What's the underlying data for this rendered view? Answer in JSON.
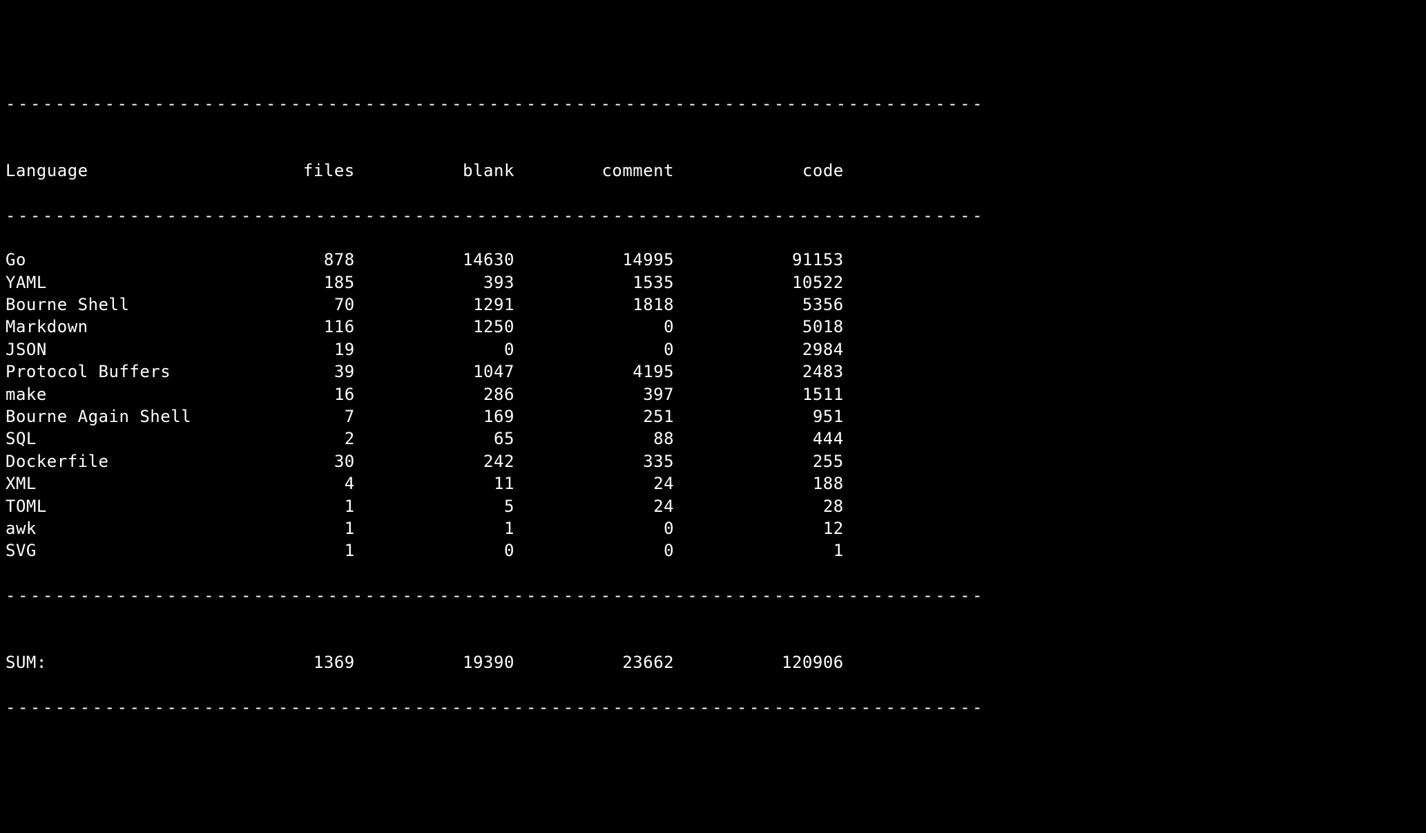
{
  "headers": {
    "language": "Language",
    "files": "files",
    "blank": "blank",
    "comment": "comment",
    "code": "code"
  },
  "separator": "-------------------------------------------------------------------------------",
  "rows": [
    {
      "language": "Go",
      "files": "878",
      "blank": "14630",
      "comment": "14995",
      "code": "91153"
    },
    {
      "language": "YAML",
      "files": "185",
      "blank": "393",
      "comment": "1535",
      "code": "10522"
    },
    {
      "language": "Bourne Shell",
      "files": "70",
      "blank": "1291",
      "comment": "1818",
      "code": "5356"
    },
    {
      "language": "Markdown",
      "files": "116",
      "blank": "1250",
      "comment": "0",
      "code": "5018"
    },
    {
      "language": "JSON",
      "files": "19",
      "blank": "0",
      "comment": "0",
      "code": "2984"
    },
    {
      "language": "Protocol Buffers",
      "files": "39",
      "blank": "1047",
      "comment": "4195",
      "code": "2483"
    },
    {
      "language": "make",
      "files": "16",
      "blank": "286",
      "comment": "397",
      "code": "1511"
    },
    {
      "language": "Bourne Again Shell",
      "files": "7",
      "blank": "169",
      "comment": "251",
      "code": "951"
    },
    {
      "language": "SQL",
      "files": "2",
      "blank": "65",
      "comment": "88",
      "code": "444"
    },
    {
      "language": "Dockerfile",
      "files": "30",
      "blank": "242",
      "comment": "335",
      "code": "255"
    },
    {
      "language": "XML",
      "files": "4",
      "blank": "11",
      "comment": "24",
      "code": "188"
    },
    {
      "language": "TOML",
      "files": "1",
      "blank": "5",
      "comment": "24",
      "code": "28"
    },
    {
      "language": "awk",
      "files": "1",
      "blank": "1",
      "comment": "0",
      "code": "12"
    },
    {
      "language": "SVG",
      "files": "1",
      "blank": "0",
      "comment": "0",
      "code": "1"
    }
  ],
  "sum": {
    "language": "SUM:",
    "files": "1369",
    "blank": "19390",
    "comment": "23662",
    "code": "120906"
  },
  "chart_data": {
    "type": "table",
    "columns": [
      "Language",
      "files",
      "blank",
      "comment",
      "code"
    ],
    "rows": [
      [
        "Go",
        878,
        14630,
        14995,
        91153
      ],
      [
        "YAML",
        185,
        393,
        1535,
        10522
      ],
      [
        "Bourne Shell",
        70,
        1291,
        1818,
        5356
      ],
      [
        "Markdown",
        116,
        1250,
        0,
        5018
      ],
      [
        "JSON",
        19,
        0,
        0,
        2984
      ],
      [
        "Protocol Buffers",
        39,
        1047,
        4195,
        2483
      ],
      [
        "make",
        16,
        286,
        397,
        1511
      ],
      [
        "Bourne Again Shell",
        7,
        169,
        251,
        951
      ],
      [
        "SQL",
        2,
        65,
        88,
        444
      ],
      [
        "Dockerfile",
        30,
        242,
        335,
        255
      ],
      [
        "XML",
        4,
        11,
        24,
        188
      ],
      [
        "TOML",
        1,
        5,
        24,
        28
      ],
      [
        "awk",
        1,
        1,
        0,
        12
      ],
      [
        "SVG",
        1,
        0,
        0,
        1
      ]
    ],
    "totals": {
      "files": 1369,
      "blank": 19390,
      "comment": 23662,
      "code": 120906
    }
  }
}
